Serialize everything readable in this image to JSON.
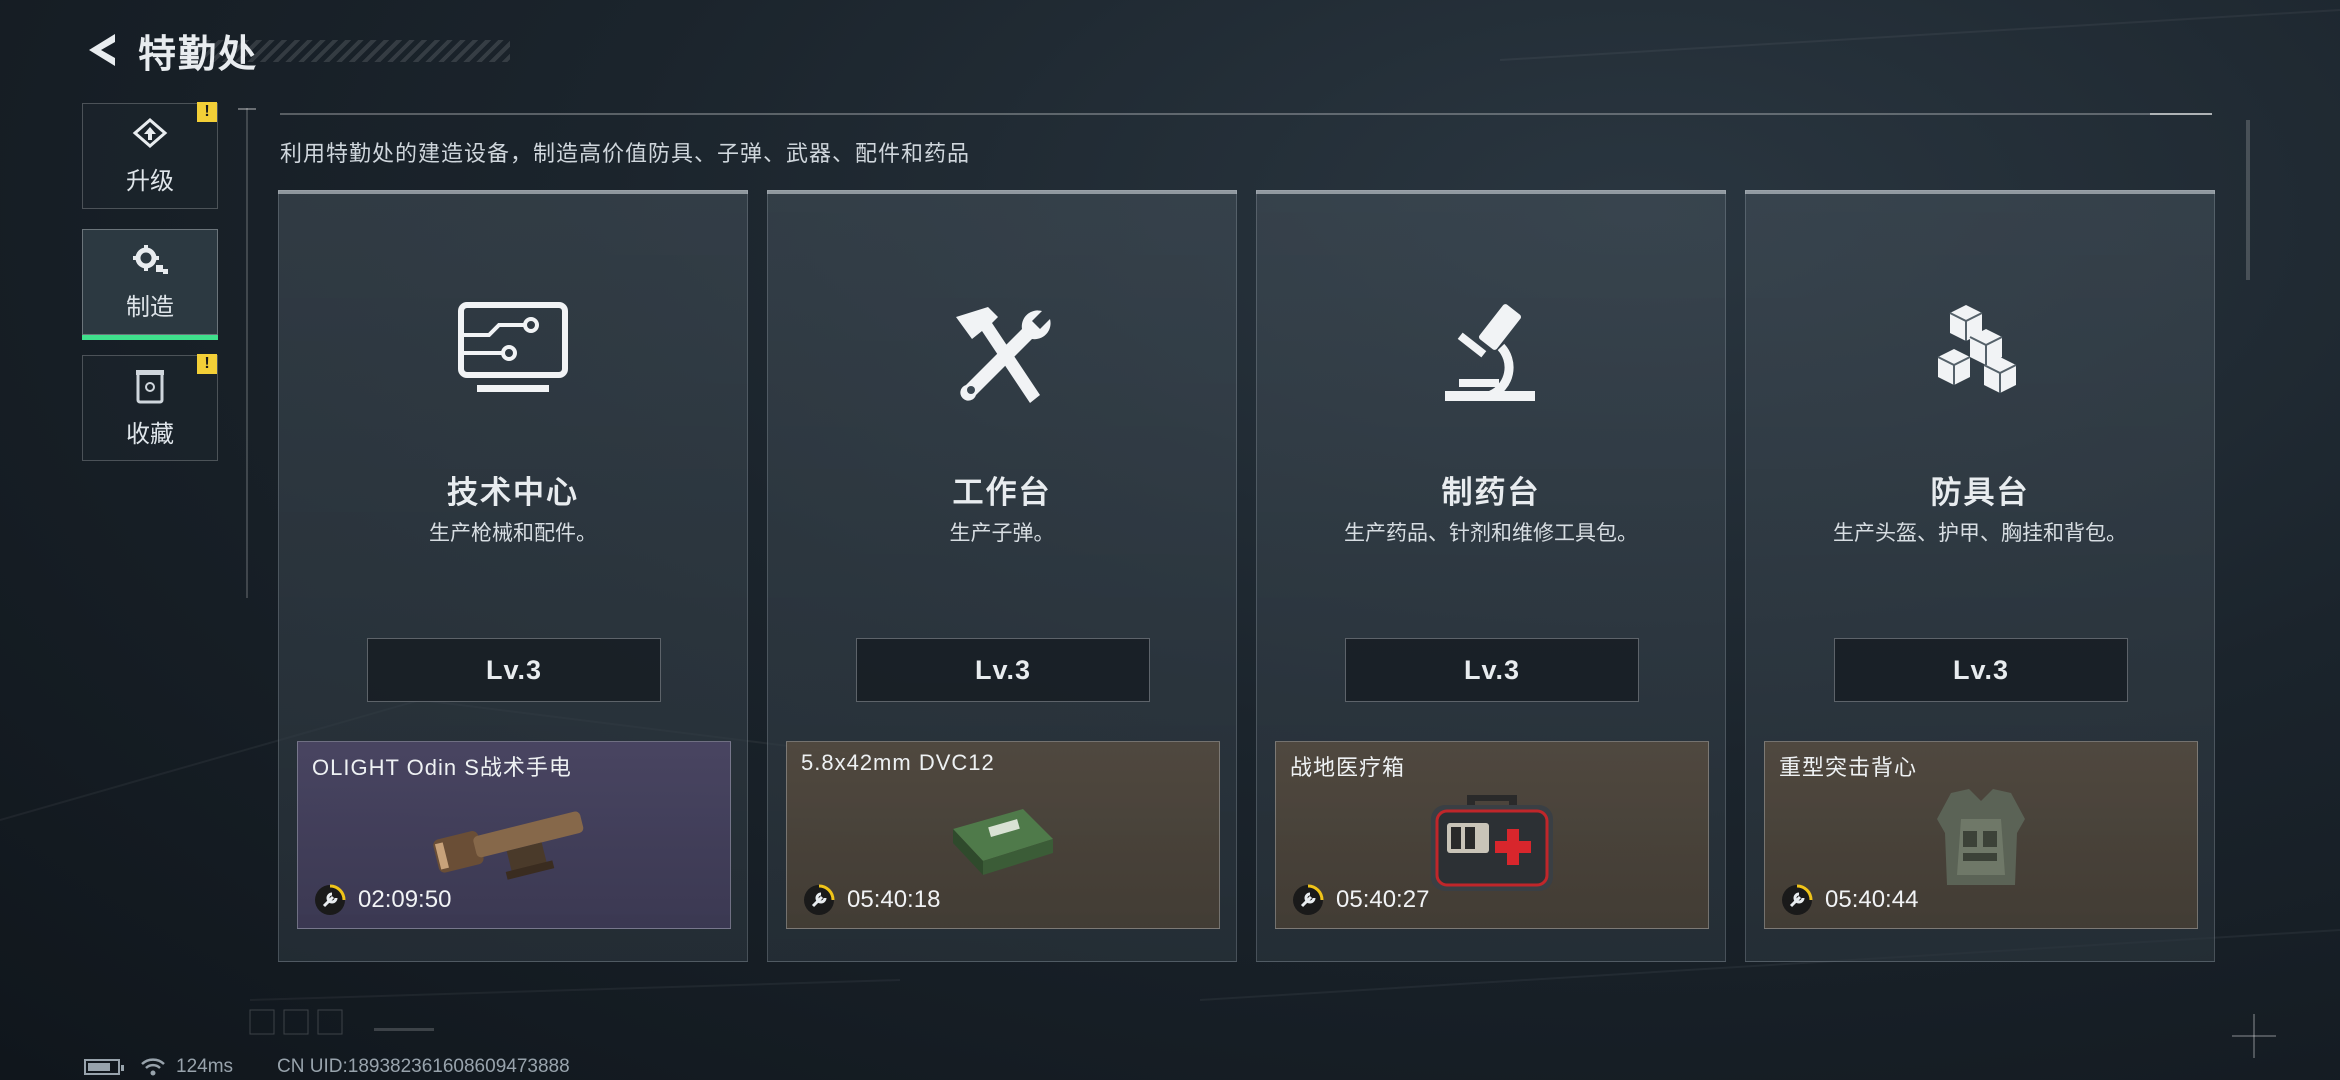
{
  "header": {
    "title": "特勤处"
  },
  "sidebar": {
    "items": [
      {
        "label": "升级",
        "warning": "!"
      },
      {
        "label": "制造"
      },
      {
        "label": "收藏",
        "warning": "!"
      }
    ]
  },
  "subtitle": "利用特勤处的建造设备，制造高价值防具、子弹、武器、配件和药品",
  "cards": [
    {
      "name": "技术中心",
      "desc": "生产枪械和配件。",
      "level": "Lv.3",
      "product": {
        "name": "OLIGHT Odin S战术手电",
        "time": "02:09:50"
      }
    },
    {
      "name": "工作台",
      "desc": "生产子弹。",
      "level": "Lv.3",
      "product": {
        "name": "5.8x42mm DVC12",
        "time": "05:40:18"
      }
    },
    {
      "name": "制药台",
      "desc": "生产药品、针剂和维修工具包。",
      "level": "Lv.3",
      "product": {
        "name": "战地医疗箱",
        "time": "05:40:27"
      }
    },
    {
      "name": "防具台",
      "desc": "生产头盔、护甲、胸挂和背包。",
      "level": "Lv.3",
      "product": {
        "name": "重型突击背心",
        "time": "05:40:44"
      }
    }
  ],
  "status": {
    "ping": "124ms",
    "uid": "CN UID:1893823616086​09473888"
  },
  "colors": {
    "accent": "#3fe08c",
    "warning": "#f3cf37",
    "timer": "#f0c419"
  }
}
